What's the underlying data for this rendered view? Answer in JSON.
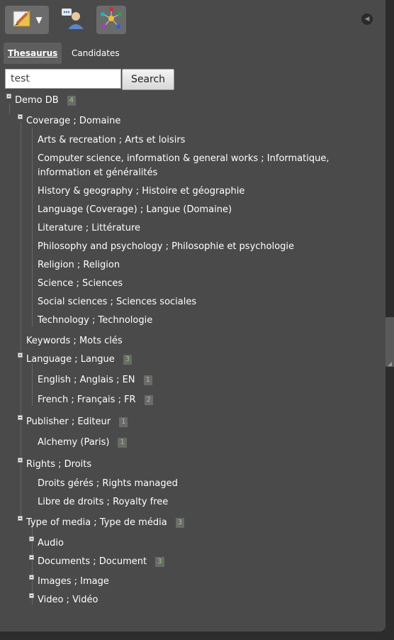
{
  "toolbar": {
    "edit_icon": "pencil-ruler-icon",
    "dropdown_icon": "caret-down-icon",
    "users_icon": "users-chat-icon",
    "graph_icon": "network-graph-icon",
    "collapse_icon": "collapse-left-icon"
  },
  "tabs": {
    "thesaurus": "Thesaurus",
    "candidates": "Candidates"
  },
  "search": {
    "value": "test",
    "button_label": "Search"
  },
  "tree": {
    "root": {
      "label": "Demo DB",
      "count": "4"
    },
    "coverage": {
      "label": "Coverage ; Domaine",
      "children": [
        "Arts & recreation ; Arts et loisirs",
        "Computer science, information & general works ; Informatique, information et généralités",
        "History & geography ; Histoire et géographie",
        "Language (Coverage) ; Langue (Domaine)",
        "Literature ; Littérature",
        "Philosophy and psychology ; Philosophie et psychologie",
        "Religion ; Religion",
        "Science ; Sciences",
        "Social sciences ; Sciences sociales",
        "Technology ; Technologie"
      ]
    },
    "keywords": {
      "label": "Keywords ; Mots clés"
    },
    "language": {
      "label": "Language ; Langue",
      "count": "3",
      "children": [
        {
          "label": "English ; Anglais ; EN",
          "count": "1"
        },
        {
          "label": "French ; Français ; FR",
          "count": "2"
        }
      ]
    },
    "publisher": {
      "label": "Publisher ; Editeur",
      "count": "1",
      "children": [
        {
          "label": "Alchemy (Paris)",
          "count": "1"
        }
      ]
    },
    "rights": {
      "label": "Rights ; Droits",
      "children": [
        "Droits gérés ; Rights managed",
        "Libre de droits ; Royalty free"
      ]
    },
    "media": {
      "label": "Type of media ; Type de média",
      "count": "3",
      "children": [
        {
          "label": "Audio"
        },
        {
          "label": "Documents ; Document",
          "count": "3"
        },
        {
          "label": "Images ; Image"
        },
        {
          "label": "Video ; Vidéo"
        }
      ]
    }
  },
  "colors": {
    "panel_bg": "#4a4a4a",
    "outer_bg": "#2c2c2c",
    "badge_text": "#8fd16a"
  }
}
